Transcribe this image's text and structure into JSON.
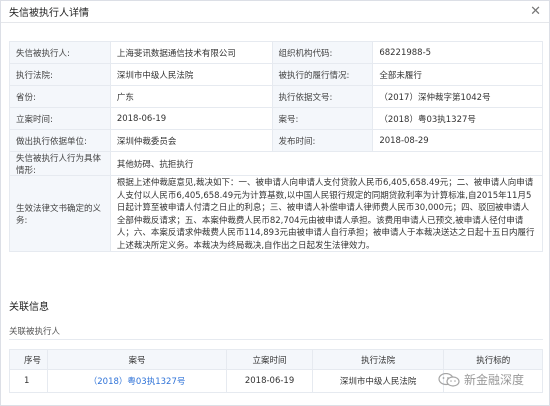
{
  "window": {
    "title": "失信被执行人详情"
  },
  "detail": {
    "rows": [
      [
        {
          "label": "失信被执行人:",
          "value": "上海斐讯数据通信技术有限公司"
        },
        {
          "label": "组织机构代码:",
          "value": "68221988-5"
        }
      ],
      [
        {
          "label": "执行法院:",
          "value": "深圳市中级人民法院"
        },
        {
          "label": "被执行的履行情况:",
          "value": "全部未履行"
        }
      ],
      [
        {
          "label": "省份:",
          "value": "广东"
        },
        {
          "label": "执行依据文号:",
          "value": "（2017）深仲裁字第1042号"
        }
      ],
      [
        {
          "label": "立案时间:",
          "value": "2018-06-19"
        },
        {
          "label": "案号:",
          "value": "（2018）粤03执1327号"
        }
      ],
      [
        {
          "label": "做出执行依据单位:",
          "value": "深圳仲裁委员会"
        },
        {
          "label": "发布时间:",
          "value": "2018-08-29"
        }
      ]
    ],
    "behavior": {
      "label": "失信被执行人行为具体情形:",
      "value": "其他妨碍、抗拒执行"
    },
    "obligation": {
      "label": "生效法律文书确定的义务:",
      "value": "根据上述仲裁庭意见,裁决如下：一、被申请人向申请人支付贷款人民币6,405,658.49元；二、被申请人向申请人支付以人民币6,405,658.49元为计算基数,以中国人民银行规定的同期贷款利率为计算标准,自2015年11月5日起计算至被申请人付清之日止的利息；三、被申请人补偿申请人律师费人民币30,000元；四、驳回被申请人全部仲裁反请求；五、本案仲裁费人民币82,704元由被申请人承担。该费用申请人已预交,被申请人径付申请人；六、本案反请求仲裁费人民币114,893元由被申请人自行承担；被申请人于本裁决送达之日起十五日内履行上述裁决所定义务。本裁决为终局裁决,自作出之日起发生法律效力。"
    }
  },
  "related": {
    "section_title": "关联信息",
    "sub_title": "关联被执行人",
    "columns": [
      "序号",
      "案号",
      "立案时间",
      "执行法院",
      "执行标的"
    ],
    "rows": [
      {
        "index": "1",
        "case_no": "（2018）粤03执1327号",
        "date": "2018-06-19",
        "court": "深圳市中级人民法院",
        "amount": ""
      }
    ]
  },
  "watermark": {
    "text": "新金融深度"
  }
}
